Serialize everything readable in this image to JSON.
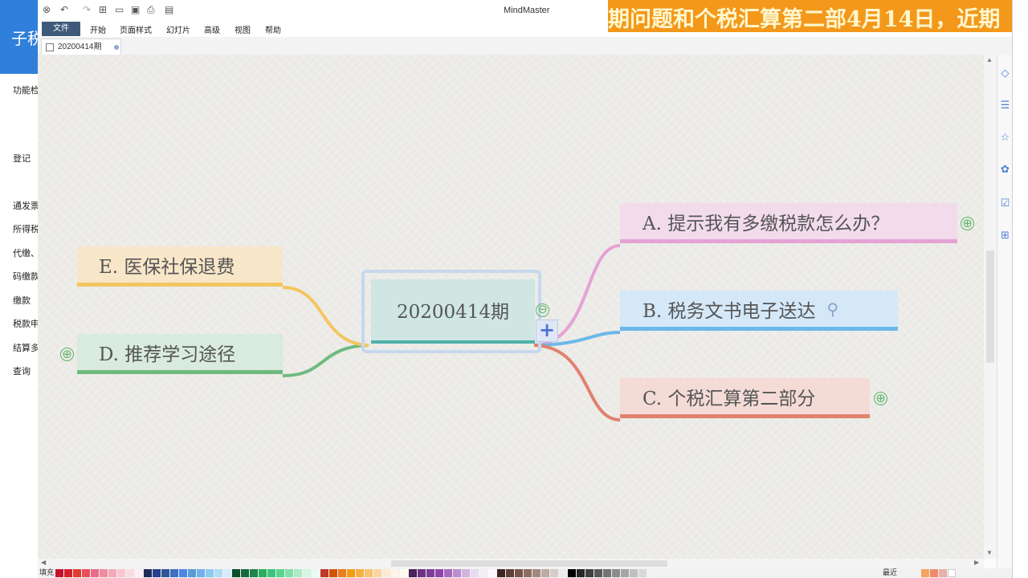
{
  "app": {
    "title": "MindMaster"
  },
  "menu": {
    "items": [
      "文件",
      "开始",
      "页面样式",
      "幻灯片",
      "高级",
      "视图",
      "帮助"
    ]
  },
  "document": {
    "tab_label": "20200414期"
  },
  "mindmap": {
    "central": "20200414期",
    "branches": [
      {
        "text": "A. 提示我有多缴税款怎么办？",
        "color": "#e4a3d4",
        "fill": "#f2dcec",
        "expand": "⊕"
      },
      {
        "text": "B. 税务文书电子送达",
        "color": "#6cb8ea",
        "fill": "#d4e8f8",
        "attachment_icon": "paperclip-icon"
      },
      {
        "text": "C. 个税汇算第二部分",
        "color": "#e0826e",
        "fill": "#f4dbd6",
        "expand": "⊕"
      },
      {
        "text": "D. 推荐学习途径",
        "color": "#6fba7e",
        "fill": "#d8ebdc",
        "expand": "⊕"
      },
      {
        "text": "E. 医保社保退费",
        "color": "#f4c660",
        "fill": "#f8e6c8"
      }
    ],
    "collapse": "⊖",
    "add": "+"
  },
  "banner": {
    "text": "期问题和个税汇算第二部4月14日，近期"
  },
  "leftstrip": {
    "logo": "子税",
    "items": [
      "功能检",
      "登记",
      "通发票",
      "所得税",
      "代缴、",
      "码缴款",
      "缴款",
      "税款申",
      "结算多",
      "查询"
    ]
  },
  "palette": {
    "label": "填充",
    "recent_label": "最近"
  }
}
